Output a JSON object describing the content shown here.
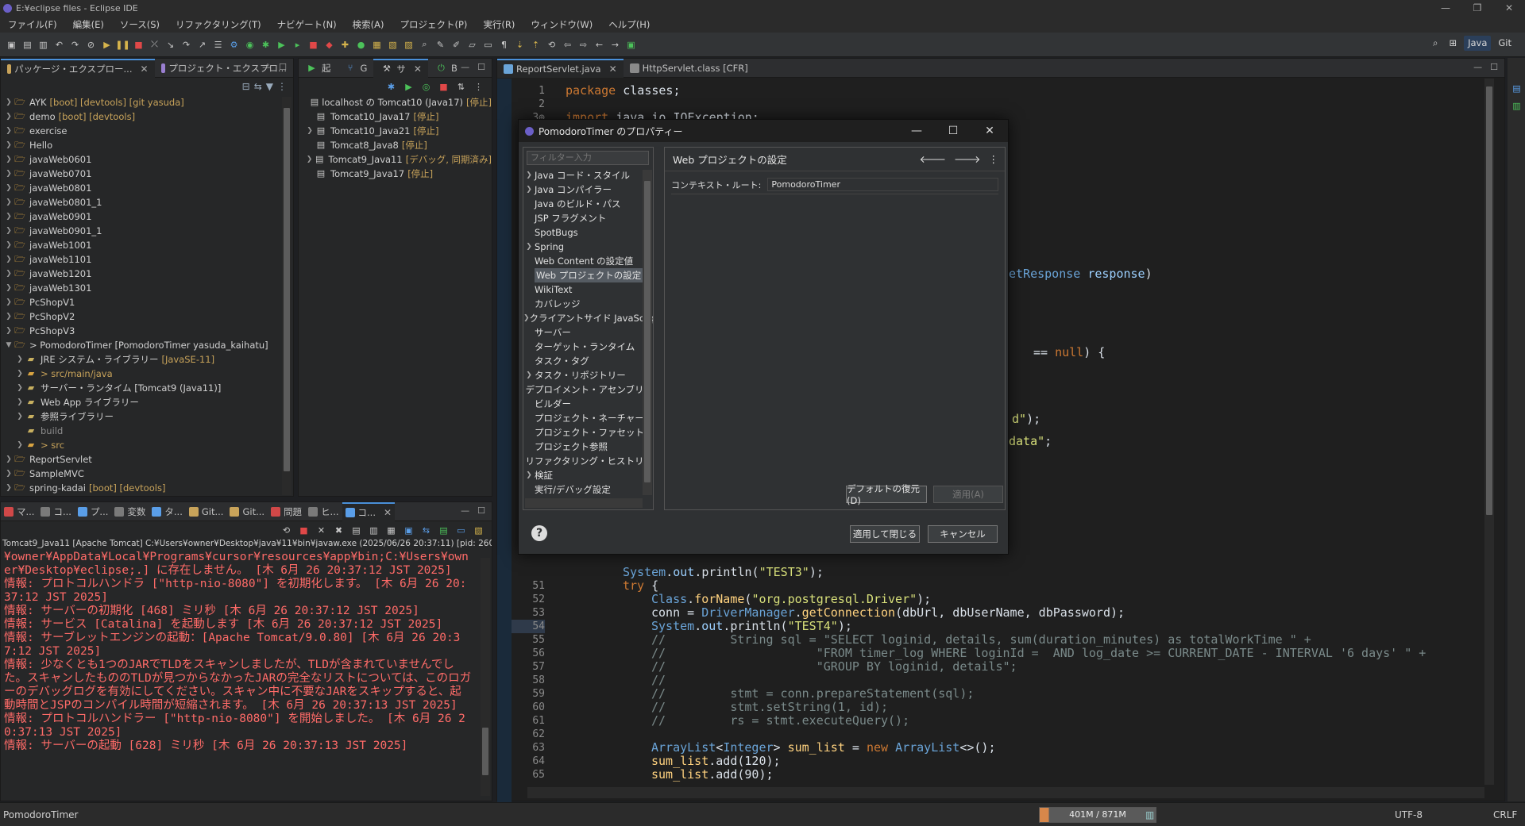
{
  "window": {
    "title": "E:¥eclipse files - Eclipse IDE"
  },
  "menu": [
    "ファイル(F)",
    "編集(E)",
    "ソース(S)",
    "リファクタリング(T)",
    "ナビゲート(N)",
    "検索(A)",
    "プロジェクト(P)",
    "実行(R)",
    "ウィンドウ(W)",
    "ヘルプ(H)"
  ],
  "perspectives": [
    "Java",
    "Git"
  ],
  "explorer": {
    "tabs": [
      "パッケージ・エクスプロー...",
      "プロジェクト・エクスプロ..."
    ],
    "items": [
      {
        "label": "AYK",
        "deco": "[boot] [devtools] [git yasuda]",
        "level": 0
      },
      {
        "label": "demo",
        "deco": "[boot] [devtools]",
        "level": 0
      },
      {
        "label": "exercise",
        "deco": "",
        "level": 0
      },
      {
        "label": "Hello",
        "deco": "",
        "level": 0
      },
      {
        "label": "javaWeb0601",
        "deco": "",
        "level": 0
      },
      {
        "label": "javaWeb0701",
        "deco": "",
        "level": 0
      },
      {
        "label": "javaWeb0801",
        "deco": "",
        "level": 0
      },
      {
        "label": "javaWeb0801_1",
        "deco": "",
        "level": 0
      },
      {
        "label": "javaWeb0901",
        "deco": "",
        "level": 0
      },
      {
        "label": "javaWeb0901_1",
        "deco": "",
        "level": 0
      },
      {
        "label": "javaWeb1001",
        "deco": "",
        "level": 0
      },
      {
        "label": "javaWeb1101",
        "deco": "",
        "level": 0
      },
      {
        "label": "javaWeb1201",
        "deco": "",
        "level": 0
      },
      {
        "label": "javaWeb1301",
        "deco": "",
        "level": 0
      },
      {
        "label": "PcShopV1",
        "deco": "",
        "level": 0
      },
      {
        "label": "PcShopV2",
        "deco": "",
        "level": 0
      },
      {
        "label": "PcShopV3",
        "deco": "",
        "level": 0
      },
      {
        "label": "> PomodoroTimer [PomodoroTimer yasuda_kaihatu]",
        "deco": "",
        "level": 0,
        "open": true
      },
      {
        "label": "JRE システム・ライブラリー",
        "deco": "[JavaSE-11]",
        "level": 1
      },
      {
        "label": "> src/main/java",
        "deco": "",
        "level": 1,
        "warn": true
      },
      {
        "label": "サーバー・ランタイム [Tomcat9 (Java11)]",
        "deco": "",
        "level": 1
      },
      {
        "label": "Web App ライブラリー",
        "deco": "",
        "level": 1
      },
      {
        "label": "参照ライブラリー",
        "deco": "",
        "level": 1
      },
      {
        "label": "build",
        "deco": "",
        "level": 1,
        "dim": true,
        "leaf": true
      },
      {
        "label": "> src",
        "deco": "",
        "level": 1,
        "warn": true
      },
      {
        "label": "ReportServlet",
        "deco": "",
        "level": 0
      },
      {
        "label": "SampleMVC",
        "deco": "",
        "level": 0
      },
      {
        "label": "spring-kadai",
        "deco": "[boot] [devtools]",
        "level": 0
      }
    ]
  },
  "servers": {
    "tabs": [
      "起",
      "G",
      "サ",
      "B"
    ],
    "items": [
      {
        "label": "localhost の Tomcat10 (Java17)",
        "deco": "[停止]",
        "arrow": false
      },
      {
        "label": "Tomcat10_Java17",
        "deco": "[停止]",
        "arrow": false
      },
      {
        "label": "Tomcat10_Java21",
        "deco": "[停止]",
        "arrow": true
      },
      {
        "label": "Tomcat8_Java8",
        "deco": "[停止]",
        "arrow": false
      },
      {
        "label": "Tomcat9_Java11",
        "deco": "[デバッグ, 同期済み]",
        "arrow": true
      },
      {
        "label": "Tomcat9_Java17",
        "deco": "[停止]",
        "arrow": false
      }
    ]
  },
  "console": {
    "tabs": [
      "マ...",
      "コ...",
      "プ...",
      "変数",
      "タ...",
      "Git...",
      "Git...",
      "問題",
      "ヒ...",
      "コ..."
    ],
    "header": "Tomcat9_Java11 [Apache Tomcat] C:¥Users¥owner¥Desktop¥java¥11¥bin¥javaw.exe (2025/06/26 20:37:11) [pid: 2604]",
    "text": "¥owner¥AppData¥Local¥Programs¥cursor¥resources¥app¥bin;C:¥Users¥owner¥Desktop¥eclipse;.] に存在しません。 [木 6月 26 20:37:12 JST 2025]\n情報: プロトコルハンドラ [\"http-nio-8080\"] を初期化します。 [木 6月 26 20:37:12 JST 2025]\n情報: サーバーの初期化 [468] ミリ秒 [木 6月 26 20:37:12 JST 2025]\n情報: サービス [Catalina] を起動します [木 6月 26 20:37:12 JST 2025]\n情報: サーブレットエンジンの起動：[Apache Tomcat/9.0.80] [木 6月 26 20:37:12 JST 2025]\n情報: 少なくとも1つのJARでTLDをスキャンしましたが、TLDが含まれていませんでした。スキャンしたもののTLDが見つからなかったJARの完全なリストについては、このロガーのデバッグログを有効にしてください。スキャン中に不要なJARをスキップすると、起動時間とJSPのコンパイル時間が短縮されます。 [木 6月 26 20:37:13 JST 2025]\n情報: プロトコルハンドラー [\"http-nio-8080\"] を開始しました。 [木 6月 26 20:37:13 JST 2025]\n情報: サーバーの起動 [628] ミリ秒 [木 6月 26 20:37:13 JST 2025]"
  },
  "editor": {
    "tabs": [
      "ReportServlet.java",
      "HttpServlet.class [CFR]"
    ]
  },
  "dialog": {
    "title": "PomodoroTimer のプロパティー",
    "filter_placeholder": "フィルター入力",
    "page_title": "Web プロジェクトの設定",
    "context_root_label": "コンテキスト・ルート:",
    "context_root_value": "PomodoroTimer",
    "restore_defaults": "デフォルトの復元(D)",
    "apply": "適用(A)",
    "apply_close": "適用して閉じる",
    "cancel": "キャンセル",
    "categories": [
      {
        "label": "Java コード・スタイル",
        "arrow": true
      },
      {
        "label": "Java コンパイラー",
        "arrow": true
      },
      {
        "label": "Java のビルド・パス",
        "arrow": false
      },
      {
        "label": "JSP フラグメント",
        "arrow": false
      },
      {
        "label": "SpotBugs",
        "arrow": false
      },
      {
        "label": "Spring",
        "arrow": true
      },
      {
        "label": "Web Content の設定値",
        "arrow": false
      },
      {
        "label": "Web プロジェクトの設定",
        "arrow": false,
        "selected": true
      },
      {
        "label": "WikiText",
        "arrow": false
      },
      {
        "label": "カバレッジ",
        "arrow": false
      },
      {
        "label": "クライアントサイド JavaScript",
        "arrow": true
      },
      {
        "label": "サーバー",
        "arrow": false
      },
      {
        "label": "ターゲット・ランタイム",
        "arrow": false
      },
      {
        "label": "タスク・タグ",
        "arrow": false
      },
      {
        "label": "タスク・リポジトリー",
        "arrow": true
      },
      {
        "label": "デプロイメント・アセンブリー",
        "arrow": false
      },
      {
        "label": "ビルダー",
        "arrow": false
      },
      {
        "label": "プロジェクト・ネーチャー",
        "arrow": false
      },
      {
        "label": "プロジェクト・ファセット",
        "arrow": false
      },
      {
        "label": "プロジェクト参照",
        "arrow": false
      },
      {
        "label": "リファクタリング・ヒストリー",
        "arrow": false
      },
      {
        "label": "検証",
        "arrow": true
      },
      {
        "label": "実行/デバッグ設定",
        "arrow": false
      }
    ]
  },
  "status": {
    "left": "PomodoroTimer",
    "heap": "401M / 871M",
    "encoding": "UTF-8",
    "eol": "CRLF"
  },
  "colors": {
    "accent": "#4a90d9",
    "console_error": "#ff6b68",
    "decoration": "#c8a35a"
  }
}
